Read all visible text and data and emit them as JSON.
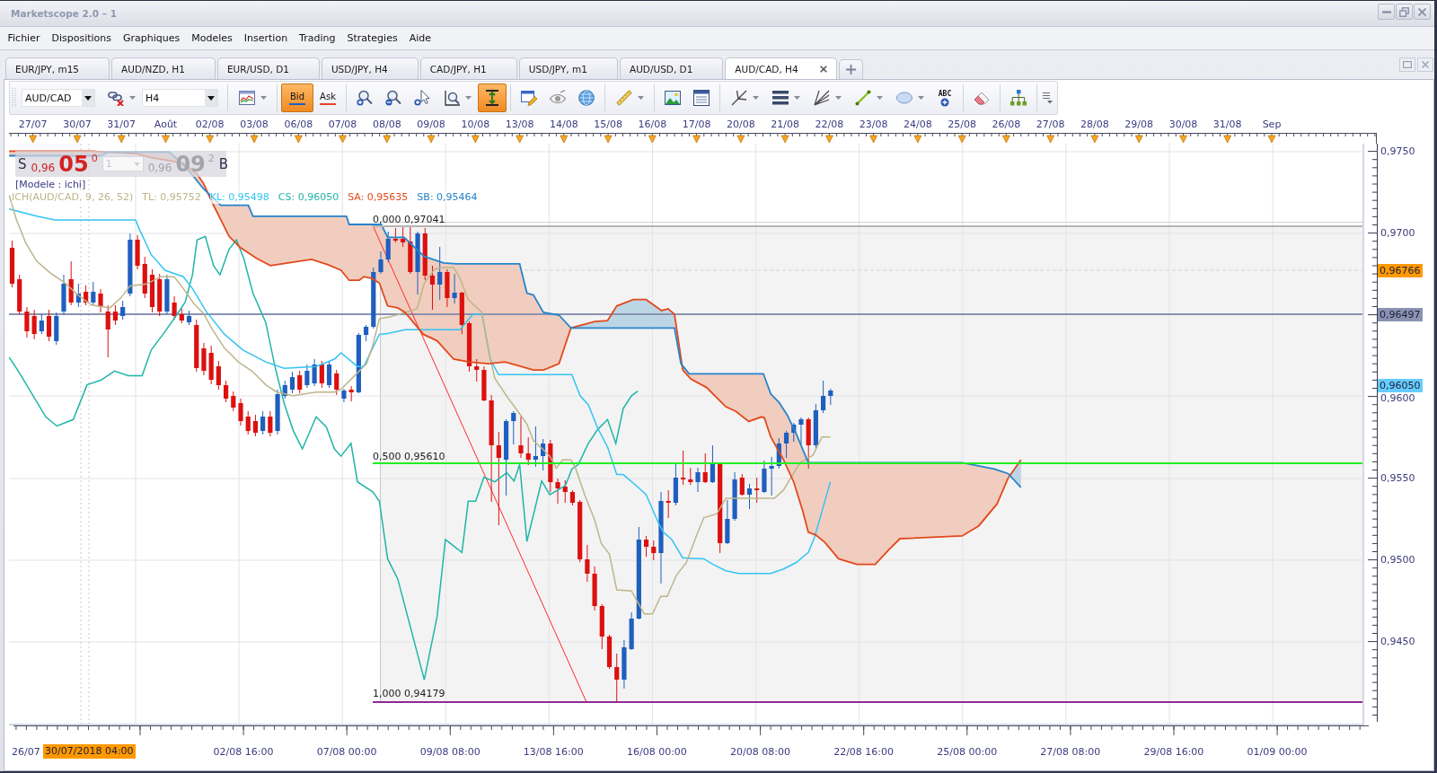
{
  "window": {
    "title": "Marketscope 2.0 – 1"
  },
  "menu": [
    "Fichier",
    "Dispositions",
    "Graphiques",
    "Modeles",
    "Insertion",
    "Trading",
    "Strategies",
    "Aide"
  ],
  "tabs": [
    {
      "label": "EUR/JPY, m15",
      "selected": false
    },
    {
      "label": "AUD/NZD, H1",
      "selected": false
    },
    {
      "label": "EUR/USD, D1",
      "selected": false
    },
    {
      "label": "USD/JPY, H4",
      "selected": false
    },
    {
      "label": "CAD/JPY, H1",
      "selected": false
    },
    {
      "label": "USD/JPY, m1",
      "selected": false
    },
    {
      "label": "AUD/USD, D1",
      "selected": false
    },
    {
      "label": "AUD/CAD, H4",
      "selected": true
    }
  ],
  "toolbar": {
    "items": [
      {
        "kind": "dropdown",
        "value": "AUD/CAD"
      },
      {
        "kind": "icon",
        "selected": false
      },
      {
        "kind": "dropdown",
        "value": "H4"
      },
      {
        "kind": "icon",
        "selected": false
      },
      {
        "kind": "price",
        "label": "Bid",
        "selected": true,
        "color": "#1f5fc8"
      },
      {
        "kind": "price",
        "label": "Ask",
        "selected": false,
        "color": "#e8402a"
      },
      {
        "kind": "icon",
        "selected": false
      },
      {
        "kind": "icon",
        "selected": false
      },
      {
        "kind": "icon",
        "selected": false
      },
      {
        "kind": "icon",
        "selected": false
      },
      {
        "kind": "icon",
        "selected": true
      },
      {
        "kind": "icon",
        "selected": false
      },
      {
        "kind": "icon",
        "selected": false
      },
      {
        "kind": "icon",
        "selected": false
      },
      {
        "kind": "icon",
        "selected": false
      },
      {
        "kind": "icon",
        "selected": false
      },
      {
        "kind": "icon",
        "selected": false
      },
      {
        "kind": "icon",
        "selected": false
      },
      {
        "kind": "icon",
        "selected": false
      },
      {
        "kind": "icon",
        "selected": false
      },
      {
        "kind": "icon",
        "selected": false
      },
      {
        "kind": "icon",
        "selected": false
      },
      {
        "kind": "icon",
        "selected": false,
        "label": "ABC"
      },
      {
        "kind": "icon",
        "selected": false
      },
      {
        "kind": "icon",
        "selected": false
      }
    ]
  },
  "chart": {
    "date_ruler": [
      "27/07",
      "30/07",
      "31/07",
      "Août",
      "02/08",
      "03/08",
      "06/08",
      "07/08",
      "08/08",
      "09/08",
      "10/08",
      "13/08",
      "14/08",
      "15/08",
      "16/08",
      "17/08",
      "20/08",
      "21/08",
      "22/08",
      "23/08",
      "24/08",
      "25/08",
      "26/08",
      "27/08",
      "28/08",
      "29/08",
      "30/08",
      "31/08",
      "Sep"
    ],
    "quote": {
      "sell": {
        "side": "S",
        "big_figure": "0,96",
        "pips": "05",
        "pipette": "0"
      },
      "amount": "1",
      "buy": {
        "side": "B",
        "big_figure": "0,96",
        "pips": "09",
        "pipette": "2"
      }
    },
    "template_label": "[Modele : ichi]",
    "indicator_legend": [
      {
        "text": "ICH(AUD/CAD, 9, 26, 52)",
        "color": "#bdb58a"
      },
      {
        "text": "TL: 0,95752",
        "color": "#bdb58a"
      },
      {
        "text": "KL: 0,95498",
        "color": "#33c4f4"
      },
      {
        "text": "CS: 0,96050",
        "color": "#1fb5a8"
      },
      {
        "text": "SA: 0,95635",
        "color": "#e2491c"
      },
      {
        "text": "SB: 0,95464",
        "color": "#2584cc"
      }
    ],
    "fibonacci_levels": [
      {
        "label": "0,000 0,97041",
        "color": "#b4b4b4"
      },
      {
        "label": "0,500 0,95610",
        "color": "#22ee22"
      },
      {
        "label": "1,000 0,94179",
        "color": "#8e2a96"
      }
    ],
    "price_axis": [
      "0,9750",
      "0,9700",
      "0,9600",
      "0,9550",
      "0,9500",
      "0,9450"
    ],
    "price_markers": [
      {
        "text": "0,96766",
        "color": "#ff9900"
      },
      {
        "text": "0,96497",
        "color": "#8a92b2"
      },
      {
        "text": "0,96050",
        "color": "#66ccff"
      }
    ],
    "time_axis": {
      "first_label": "26/07",
      "cursor_time": "30/07/2018 04:00",
      "labels": [
        "02/08 16:00",
        "07/08 00:00",
        "09/08 08:00",
        "13/08 16:00",
        "16/08 00:00",
        "20/08 08:00",
        "22/08 16:00",
        "25/08 00:00",
        "27/08 08:00",
        "29/08 16:00",
        "01/09 00:00"
      ]
    }
  }
}
